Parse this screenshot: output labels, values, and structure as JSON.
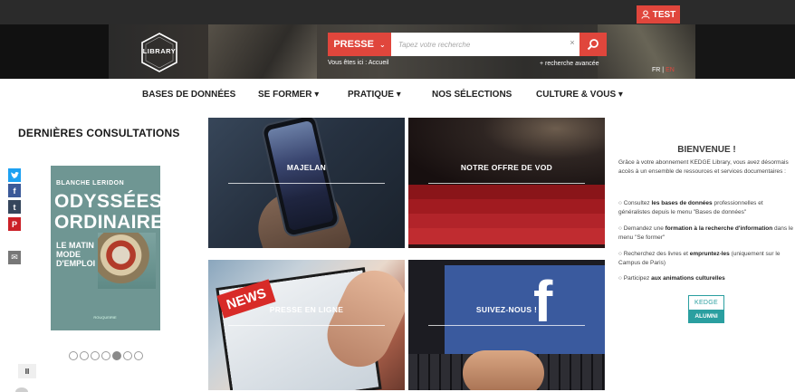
{
  "topbar": {
    "user_label": "TEST",
    "user_icon": "user-icon"
  },
  "header": {
    "logo_text": "LIBRARY",
    "search": {
      "scope_label": "PRESSE",
      "placeholder": "Tapez votre recherche",
      "clear_label": "×",
      "button_icon": "search-icon"
    },
    "breadcrumb": {
      "prefix": "Vous êtes ici :",
      "current": "Accueil"
    },
    "advanced_search": "+ recherche avancée",
    "languages": {
      "fr": "FR",
      "separator": "|",
      "en": "EN"
    }
  },
  "nav": {
    "items": [
      "BASES DE DONNÉES",
      "SE FORMER ▾",
      "PRATIQUE ▾",
      "NOS SÉLECTIONS",
      "CULTURE & VOUS ▾"
    ]
  },
  "left": {
    "title": "DERNIÈRES CONSULTATIONS",
    "social": [
      {
        "name": "twitter",
        "glyph": "t",
        "color": "#1da1f2"
      },
      {
        "name": "facebook",
        "glyph": "f",
        "color": "#3b5998"
      },
      {
        "name": "tumblr",
        "glyph": "t",
        "color": "#35465c"
      },
      {
        "name": "pinterest",
        "glyph": "P",
        "color": "#cb2027"
      },
      {
        "name": "email",
        "glyph": "✉",
        "color": "#777777"
      }
    ],
    "book": {
      "author": "BLANCHE LERIDON",
      "title_line1": "ODYSSÉES",
      "title_line2": "ORDINAIRES",
      "subtitle": "LE MATIN MODE D'EMPLOI",
      "publisher": "ROUQUEIRIE"
    },
    "carousel": {
      "count": 7,
      "active": 4
    },
    "pause_label": "II"
  },
  "tiles": [
    {
      "label": "MAJELAN"
    },
    {
      "label": "NOTRE OFFRE DE VOD"
    },
    {
      "label": "PRESSE EN LIGNE"
    },
    {
      "label": "SUIVEZ-NOUS !"
    }
  ],
  "welcome": {
    "title": "BIENVENUE !",
    "intro": "Grâce à votre abonnement KEDGE Library, vous avez désormais accès à un ensemble de ressources et services documentaires :",
    "bullets": [
      {
        "pre": "Consultez ",
        "bold": "les bases de données",
        "post": " professionnelles et généralistes depuis le menu \"Bases de données\""
      },
      {
        "pre": "Demandez une ",
        "bold": "formation à la recherche d'information",
        "post": " dans le menu \"Se former\""
      },
      {
        "pre": "Recherchez des livres et ",
        "bold": "empruntez-les",
        "post": " (uniquement sur le Campus de Paris)"
      },
      {
        "pre": "Participez ",
        "bold": "aux animations culturelles",
        "post": ""
      }
    ],
    "badge_top": "KEDGE",
    "badge_bottom": "ALUMNI"
  },
  "colors": {
    "accent": "#e0463c",
    "teal": "#2a9fa0",
    "topbar": "#2b2b2b"
  }
}
